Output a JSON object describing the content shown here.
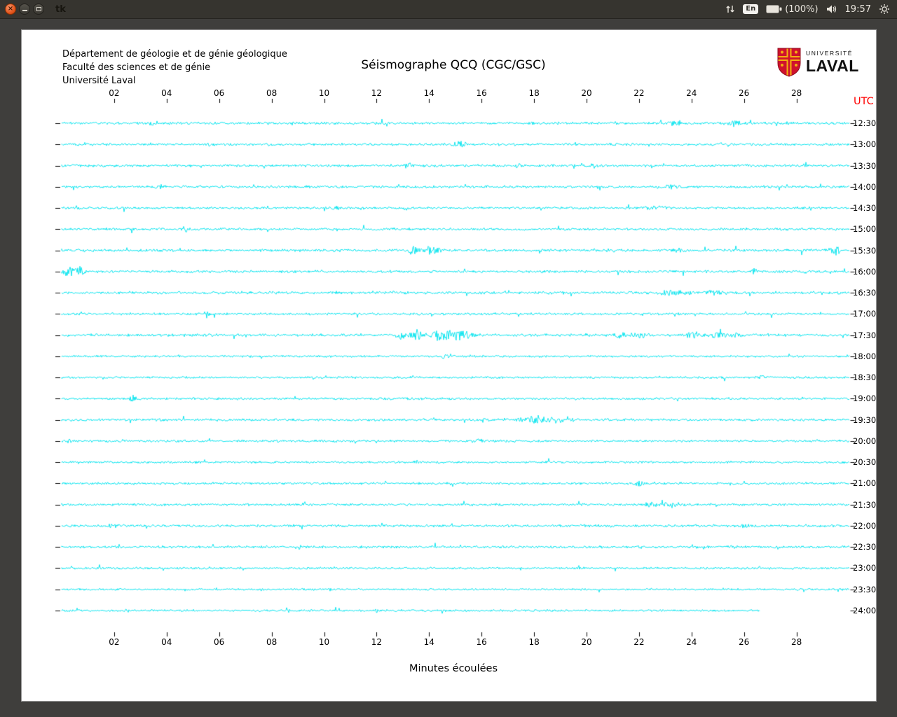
{
  "desktop": {
    "window_title": "tk"
  },
  "tray": {
    "keyboard": "En",
    "battery": "(100%)",
    "clock": "19:57",
    "icons": [
      "updown-arrows-icon",
      "keyboard-layout-indicator",
      "battery-icon",
      "volume-icon",
      "session-gear-icon"
    ]
  },
  "header": {
    "institution_lines": [
      "Département de géologie et de génie géologique",
      "Faculté des sciences et de génie",
      "Université Laval"
    ],
    "title": "Séismographe QCQ (CGC/GSC)",
    "logo": {
      "top": "UNIVERSITÉ",
      "bottom": "LAVAL"
    }
  },
  "chart_data": {
    "type": "line",
    "subtype": "helicorder-seismogram",
    "title": "Séismographe QCQ (CGC/GSC)",
    "xlabel": "Minutes écoulées",
    "right_axis_title": "UTC",
    "x_range": [
      0,
      30
    ],
    "x_tick_minutes": [
      2,
      4,
      6,
      8,
      10,
      12,
      14,
      16,
      18,
      20,
      22,
      24,
      26,
      28
    ],
    "x_tick_labels": [
      "02",
      "04",
      "06",
      "08",
      "10",
      "12",
      "14",
      "16",
      "18",
      "20",
      "22",
      "24",
      "26",
      "28"
    ],
    "trace_color": "#00E4EE",
    "utc_color": "#FF0000",
    "rows": [
      {
        "utc": "12:30",
        "noise": 1.5,
        "events": [
          {
            "m": 3.5,
            "a": 2.5,
            "w": 0.15
          },
          {
            "m": 21.0,
            "a": 2.0,
            "w": 0.1
          },
          {
            "m": 23.4,
            "a": 4.5,
            "w": 0.25
          },
          {
            "m": 25.6,
            "a": 4.0,
            "w": 0.2
          }
        ]
      },
      {
        "utc": "13:00",
        "noise": 1.5,
        "events": [
          {
            "m": 5.6,
            "a": 2.0,
            "w": 0.1
          },
          {
            "m": 15.2,
            "a": 3.5,
            "w": 0.25
          }
        ]
      },
      {
        "utc": "13:30",
        "noise": 1.5,
        "events": [
          {
            "m": 13.2,
            "a": 3.0,
            "w": 0.15
          },
          {
            "m": 17.4,
            "a": 2.5,
            "w": 0.1
          },
          {
            "m": 20.3,
            "a": 3.5,
            "w": 0.12
          }
        ]
      },
      {
        "utc": "14:00",
        "noise": 1.5,
        "events": [
          {
            "m": 3.8,
            "a": 2.8,
            "w": 0.15
          },
          {
            "m": 23.2,
            "a": 2.2,
            "w": 0.4
          }
        ]
      },
      {
        "utc": "14:30",
        "noise": 1.4,
        "events": [
          {
            "m": 10.4,
            "a": 2.8,
            "w": 0.15
          },
          {
            "m": 22.6,
            "a": 2.2,
            "w": 0.5
          }
        ]
      },
      {
        "utc": "15:00",
        "noise": 1.5,
        "events": [
          {
            "m": 4.7,
            "a": 3.5,
            "w": 0.12
          }
        ]
      },
      {
        "utc": "15:30",
        "noise": 1.6,
        "events": [
          {
            "m": 13.4,
            "a": 5.0,
            "w": 0.2
          },
          {
            "m": 14.1,
            "a": 5.0,
            "w": 0.3
          },
          {
            "m": 23.5,
            "a": 2.5,
            "w": 0.2
          },
          {
            "m": 29.5,
            "a": 6.0,
            "w": 0.18
          }
        ]
      },
      {
        "utc": "16:00",
        "noise": 1.5,
        "events": [
          {
            "m": 0.25,
            "a": 6.0,
            "w": 0.18
          },
          {
            "m": 0.65,
            "a": 7.0,
            "w": 0.2
          },
          {
            "m": 26.4,
            "a": 4.5,
            "w": 0.1
          },
          {
            "m": 28.3,
            "a": 3.5,
            "w": 0.08
          }
        ]
      },
      {
        "utc": "16:30",
        "noise": 1.7,
        "events": [
          {
            "m": 23.3,
            "a": 3.0,
            "w": 0.5
          },
          {
            "m": 24.9,
            "a": 2.5,
            "w": 0.3
          }
        ]
      },
      {
        "utc": "17:00",
        "noise": 1.4,
        "events": [
          {
            "m": 5.5,
            "a": 4.5,
            "w": 0.1
          }
        ]
      },
      {
        "utc": "17:30",
        "noise": 1.6,
        "events": [
          {
            "m": 12.9,
            "a": 5.0,
            "w": 0.2
          },
          {
            "m": 13.5,
            "a": 6.5,
            "w": 0.25
          },
          {
            "m": 14.4,
            "a": 7.0,
            "w": 0.3
          },
          {
            "m": 15.0,
            "a": 7.0,
            "w": 0.3
          },
          {
            "m": 15.5,
            "a": 5.0,
            "w": 0.2
          },
          {
            "m": 21.3,
            "a": 4.5,
            "w": 0.25
          },
          {
            "m": 22.0,
            "a": 4.5,
            "w": 0.25
          },
          {
            "m": 24.1,
            "a": 3.5,
            "w": 0.3
          },
          {
            "m": 25.0,
            "a": 4.5,
            "w": 0.25
          },
          {
            "m": 25.7,
            "a": 3.5,
            "w": 0.2
          }
        ]
      },
      {
        "utc": "18:00",
        "noise": 1.3,
        "events": [
          {
            "m": 14.6,
            "a": 1.8,
            "w": 0.2
          }
        ]
      },
      {
        "utc": "18:30",
        "noise": 1.3,
        "events": [
          {
            "m": 26.7,
            "a": 1.8,
            "w": 0.2
          }
        ]
      },
      {
        "utc": "19:00",
        "noise": 1.4,
        "events": [
          {
            "m": 2.7,
            "a": 4.5,
            "w": 0.12
          }
        ]
      },
      {
        "utc": "19:30",
        "noise": 1.5,
        "events": [
          {
            "m": 16.1,
            "a": 2.0,
            "w": 0.15
          },
          {
            "m": 18.0,
            "a": 3.0,
            "w": 0.6
          },
          {
            "m": 18.9,
            "a": 3.0,
            "w": 0.5
          }
        ]
      },
      {
        "utc": "20:00",
        "noise": 1.4,
        "events": [
          {
            "m": 0.3,
            "a": 2.0,
            "w": 0.1
          },
          {
            "m": 15.9,
            "a": 2.2,
            "w": 0.12
          }
        ]
      },
      {
        "utc": "20:30",
        "noise": 1.3,
        "events": [
          {
            "m": 13.5,
            "a": 1.8,
            "w": 0.1
          }
        ]
      },
      {
        "utc": "21:00",
        "noise": 1.4,
        "events": [
          {
            "m": 22.0,
            "a": 4.0,
            "w": 0.12
          }
        ]
      },
      {
        "utc": "21:30",
        "noise": 1.4,
        "events": [
          {
            "m": 9.1,
            "a": 1.8,
            "w": 0.1
          },
          {
            "m": 22.6,
            "a": 3.0,
            "w": 0.4
          },
          {
            "m": 23.3,
            "a": 3.0,
            "w": 0.3
          }
        ]
      },
      {
        "utc": "22:00",
        "noise": 1.5,
        "events": [
          {
            "m": 1.9,
            "a": 2.2,
            "w": 0.15
          },
          {
            "m": 26.0,
            "a": 2.0,
            "w": 0.2
          }
        ]
      },
      {
        "utc": "22:30",
        "noise": 1.5,
        "events": [
          {
            "m": 9.0,
            "a": 2.2,
            "w": 0.12
          },
          {
            "m": 25.4,
            "a": 2.0,
            "w": 0.15
          }
        ]
      },
      {
        "utc": "23:00",
        "noise": 1.3,
        "events": []
      },
      {
        "utc": "23:30",
        "noise": 1.2,
        "events": [
          {
            "m": 10.2,
            "a": 1.8,
            "w": 0.1
          }
        ]
      },
      {
        "utc": "24:00",
        "noise": 1.3,
        "end": 26.6,
        "events": [
          {
            "m": 2.5,
            "a": 1.8,
            "w": 0.1
          },
          {
            "m": 12.0,
            "a": 1.8,
            "w": 0.1
          }
        ]
      }
    ]
  }
}
